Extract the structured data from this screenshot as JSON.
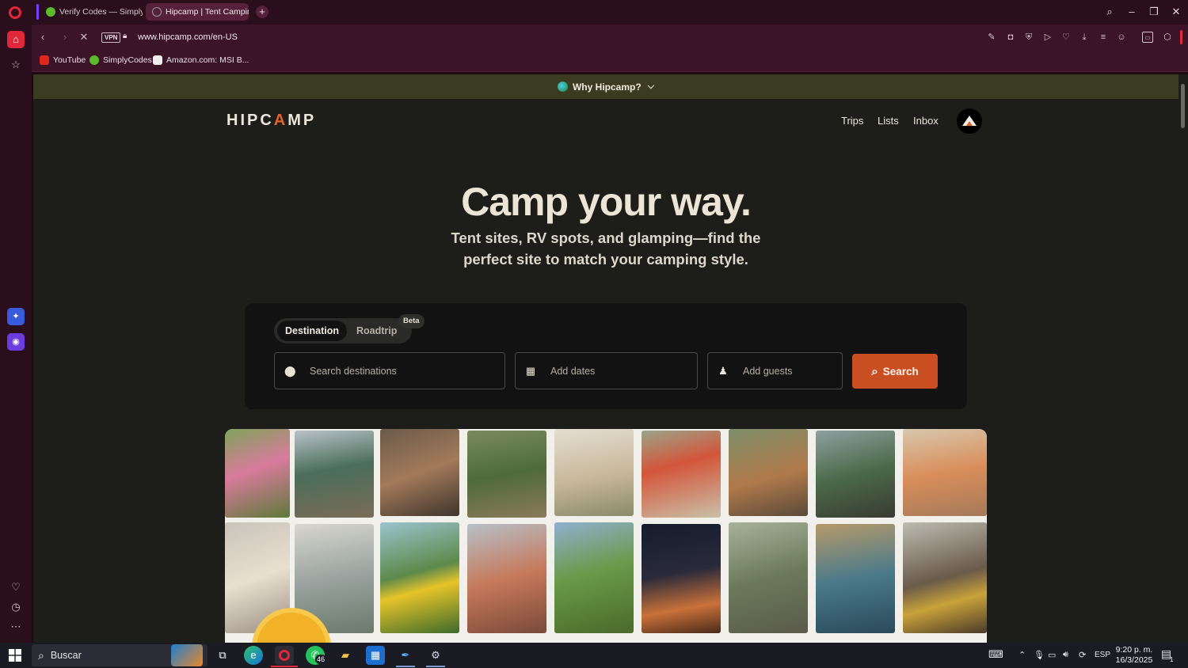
{
  "browser": {
    "tabs": [
      {
        "label": "Verify Codes — SimplyCo",
        "favicon_color": "#5cbb2c",
        "active": false
      },
      {
        "label": "Hipcamp | Tent Camping,",
        "favicon_color": "#666666",
        "active": true
      }
    ],
    "url": "www.hipcamp.com/en-US",
    "vpn_label": "VPN",
    "bookmarks": [
      {
        "label": "YouTube",
        "icon_color": "#e0261d"
      },
      {
        "label": "SimplyCodes",
        "icon_color": "#5cbb2c"
      },
      {
        "label": "Amazon.com: MSI B...",
        "icon_color": "#222222"
      }
    ]
  },
  "page": {
    "banner": {
      "label": "Why Hipcamp?"
    },
    "logo": {
      "before": "HIPC",
      "accent": "A",
      "after": "MP"
    },
    "nav": {
      "trips": "Trips",
      "lists": "Lists",
      "inbox": "Inbox"
    },
    "hero": {
      "title": "Camp your way.",
      "subtitle": "Tent sites, RV spots, and glamping—find the perfect site to match your camping style."
    },
    "search": {
      "tab_destination": "Destination",
      "tab_roadtrip": "Roadtrip",
      "beta_badge": "Beta",
      "destination_placeholder": "Search destinations",
      "dates_placeholder": "Add dates",
      "guests_placeholder": "Add guests",
      "button_label": "Search"
    },
    "colors": {
      "accent": "#c94f22",
      "banner_bg": "#3b3b21",
      "page_bg": "#1d1d1a"
    }
  },
  "taskbar": {
    "search_placeholder": "Buscar",
    "whatsapp_badge": "46",
    "language": "ESP",
    "time": "9:20 p. m.",
    "date": "16/3/2025",
    "notification_count": "1"
  }
}
